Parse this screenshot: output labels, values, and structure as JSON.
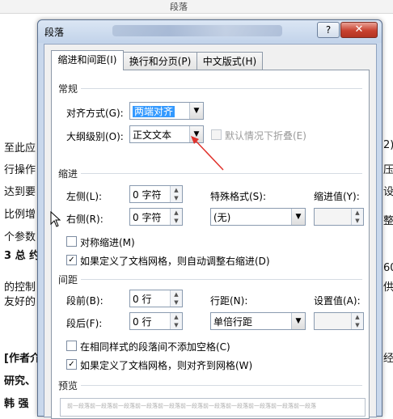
{
  "background_doc": {
    "ribbon_label": "段落",
    "lines": [
      {
        "text": "至此应",
        "cls": ""
      },
      {
        "text": "行操作",
        "cls": ""
      },
      {
        "text": "达到要",
        "cls": ""
      },
      {
        "text": "比例增",
        "cls": ""
      },
      {
        "text": "个参数",
        "cls": ""
      },
      {
        "text": "3 总 约",
        "cls": "bold"
      },
      {
        "text": "的控制",
        "cls": ""
      },
      {
        "text": "友好的",
        "cls": ""
      },
      {
        "text": "[作者介",
        "cls": "bold"
      },
      {
        "text": "研究、",
        "cls": "bold"
      },
      {
        "text": "韩 强 ",
        "cls": "bold"
      }
    ],
    "right_chars": [
      "2)",
      "压",
      "设",
      "整",
      "60",
      "供",
      "经"
    ]
  },
  "dialog": {
    "title": "段落",
    "help_icon": "?",
    "close_icon": "✕",
    "tabs": [
      "缩进和间距(I)",
      "换行和分页(P)",
      "中文版式(H)"
    ],
    "general": {
      "header": "常规",
      "alignment_label": "对齐方式(G):",
      "alignment_value": "两端对齐",
      "outline_label": "大纲级别(O):",
      "outline_value": "正文文本",
      "collapse_label": "默认情况下折叠(E)"
    },
    "indent": {
      "header": "缩进",
      "left_label": "左侧(L):",
      "left_value": "0 字符",
      "right_label": "右侧(R):",
      "right_value": "0 字符",
      "special_label": "特殊格式(S):",
      "special_value": "(无)",
      "by_label": "缩进值(Y):",
      "by_value": "",
      "mirror_label": "对称缩进(M)",
      "auto_adjust_label": "如果定义了文档网格，则自动调整右缩进(D)",
      "auto_adjust_checked": true,
      "mirror_checked": false
    },
    "spacing": {
      "header": "间距",
      "before_label": "段前(B):",
      "before_value": "0 行",
      "after_label": "段后(F):",
      "after_value": "0 行",
      "line_label": "行距(N):",
      "line_value": "单倍行距",
      "at_label": "设置值(A):",
      "at_value": "",
      "no_space_label": "在相同样式的段落间不添加空格(C)",
      "no_space_checked": false,
      "snap_grid_label": "如果定义了文档网格，则对齐到网格(W)",
      "snap_grid_checked": true
    },
    "preview": {
      "header": "预览",
      "sample": "前一段落前一段落前一段落前一段落前一段落前一段落前一段落前一段落前一段落前一段落前一段落"
    }
  },
  "colors": {
    "annotation_arrow": "#e0312b",
    "selection": "#3399ff"
  }
}
